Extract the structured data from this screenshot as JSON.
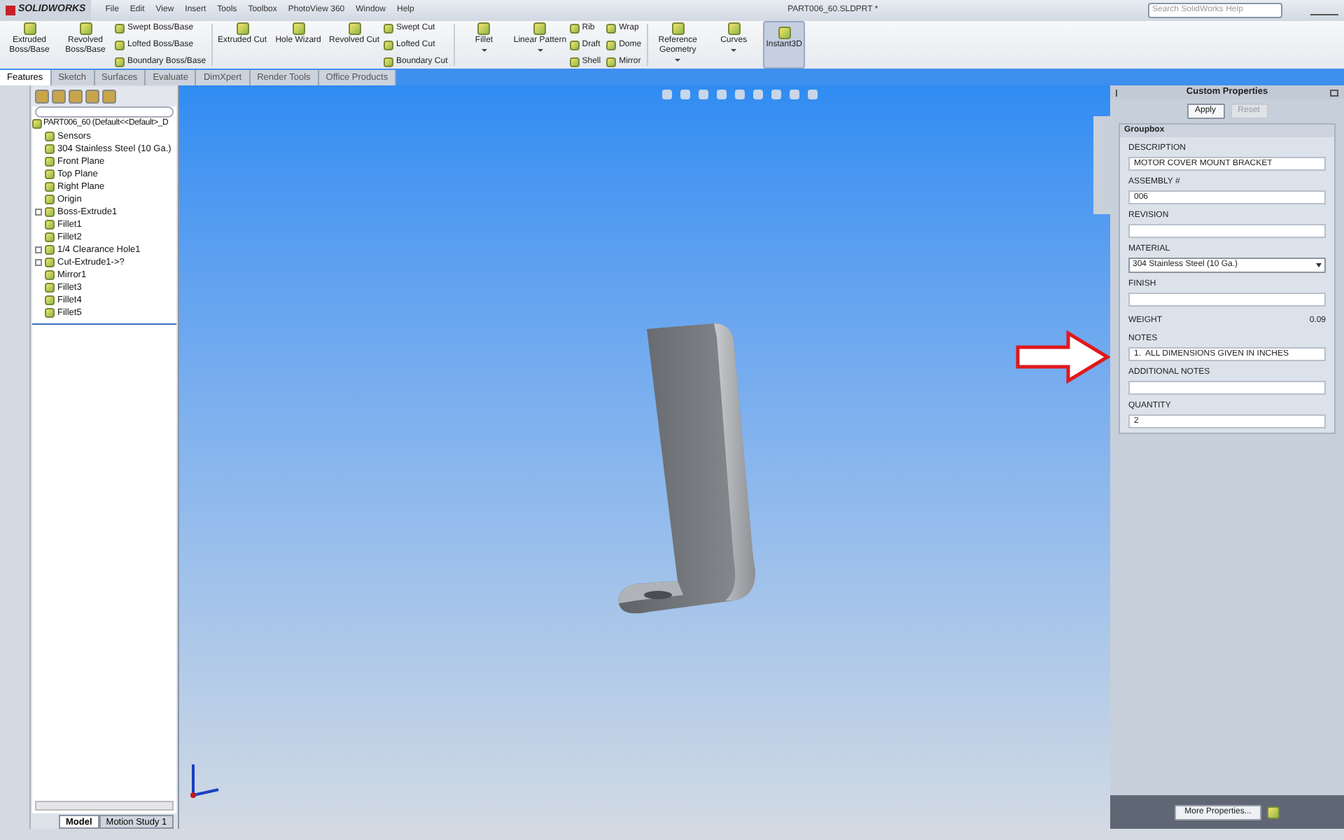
{
  "app_name": "SOLIDWORKS",
  "menu": [
    "File",
    "Edit",
    "View",
    "Insert",
    "Tools",
    "Toolbox",
    "PhotoView 360",
    "Window",
    "Help"
  ],
  "document_title": "PART006_60.SLDPRT *",
  "search": {
    "placeholder": "Search SolidWorks Help"
  },
  "ribbon": [
    {
      "kind": "large",
      "label": "Extruded Boss/Base"
    },
    {
      "kind": "large",
      "label": "Revolved Boss/Base"
    },
    {
      "kind": "stack",
      "items": [
        "Swept Boss/Base",
        "Lofted Boss/Base",
        "Boundary Boss/Base"
      ]
    },
    {
      "kind": "separator"
    },
    {
      "kind": "large",
      "label": "Extruded Cut"
    },
    {
      "kind": "large",
      "label": "Hole Wizard"
    },
    {
      "kind": "large",
      "label": "Revolved Cut"
    },
    {
      "kind": "stack",
      "items": [
        "Swept Cut",
        "Lofted Cut",
        "Boundary Cut"
      ]
    },
    {
      "kind": "separator"
    },
    {
      "kind": "large",
      "label": "Fillet",
      "dropdown": true
    },
    {
      "kind": "large",
      "label": "Linear Pattern",
      "dropdown": true
    },
    {
      "kind": "stack",
      "items": [
        "Rib",
        "Draft",
        "Shell"
      ]
    },
    {
      "kind": "stack",
      "items": [
        "Wrap",
        "Dome",
        "Mirror"
      ]
    },
    {
      "kind": "separator"
    },
    {
      "kind": "large",
      "label": "Reference Geometry",
      "dropdown": true
    },
    {
      "kind": "large",
      "label": "Curves",
      "dropdown": true
    },
    {
      "kind": "toggle",
      "label": "Instant3D",
      "on": true
    }
  ],
  "tabs": [
    {
      "label": "Features",
      "selected": true
    },
    {
      "label": "Sketch",
      "selected": false
    },
    {
      "label": "Surfaces",
      "selected": false
    },
    {
      "label": "Evaluate",
      "selected": false
    },
    {
      "label": "DimXpert",
      "selected": false
    },
    {
      "label": "Render Tools",
      "selected": false
    },
    {
      "label": "Office Products",
      "selected": false
    }
  ],
  "feature_tree": {
    "root": "PART006_60  (Default<<Default>_D",
    "items": [
      {
        "label": "Sensors",
        "expandable": false
      },
      {
        "label": "304 Stainless Steel (10 Ga.)",
        "expandable": false
      },
      {
        "label": "Front Plane",
        "expandable": false
      },
      {
        "label": "Top Plane",
        "expandable": false
      },
      {
        "label": "Right Plane",
        "expandable": false
      },
      {
        "label": "Origin",
        "expandable": false
      },
      {
        "label": "Boss-Extrude1",
        "expandable": true
      },
      {
        "label": "Fillet1",
        "expandable": false
      },
      {
        "label": "Fillet2",
        "expandable": false
      },
      {
        "label": "1/4 Clearance Hole1",
        "expandable": true
      },
      {
        "label": "Cut-Extrude1->?",
        "expandable": true
      },
      {
        "label": "Mirror1",
        "expandable": false
      },
      {
        "label": "Fillet3",
        "expandable": false
      },
      {
        "label": "Fillet4",
        "expandable": false
      },
      {
        "label": "Fillet5",
        "expandable": false
      }
    ]
  },
  "bottom_tabs": [
    {
      "label": "Model",
      "selected": true
    },
    {
      "label": "Motion Study 1",
      "selected": false
    }
  ],
  "custom_properties": {
    "title": "Custom Properties",
    "buttons": [
      {
        "label": "Apply",
        "disabled": false
      },
      {
        "label": "Reset",
        "disabled": true
      }
    ],
    "group_title": "Groupbox",
    "fields": [
      {
        "kind": "text",
        "label": "DESCRIPTION",
        "value": "MOTOR COVER MOUNT BRACKET"
      },
      {
        "kind": "text",
        "label": "ASSEMBLY #",
        "value": "006"
      },
      {
        "kind": "text",
        "label": "REVISION"
      },
      {
        "kind": "select",
        "label": "MATERIAL",
        "value": "304 Stainless Steel (10 Ga.)"
      },
      {
        "kind": "text",
        "label": "FINISH"
      },
      {
        "kind": "readout",
        "label": "WEIGHT",
        "value": "0.09"
      },
      {
        "kind": "text",
        "label": "NOTES",
        "value": "1.  ALL DIMENSIONS GIVEN IN INCHES"
      },
      {
        "kind": "text",
        "label": "ADDITIONAL NOTES"
      },
      {
        "kind": "text",
        "label": "QUANTITY",
        "value": "2"
      }
    ],
    "more_button": "More Properties..."
  }
}
